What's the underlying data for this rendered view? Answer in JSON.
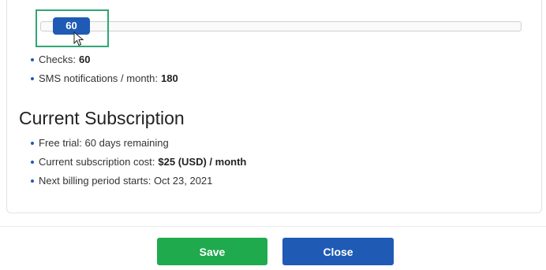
{
  "slider": {
    "value": "60",
    "value_fraction": 0.04
  },
  "plan": {
    "items": [
      {
        "label": "Checks:",
        "value": "60"
      },
      {
        "label": "SMS notifications / month:",
        "value": "180"
      }
    ]
  },
  "current_subscription": {
    "title": "Current Subscription",
    "items": [
      {
        "label": "Free trial: 60 days remaining",
        "value": ""
      },
      {
        "label": "Current subscription cost:",
        "value": "$25 (USD) / month"
      },
      {
        "label": "Next billing period starts: Oct 23, 2021",
        "value": ""
      }
    ]
  },
  "buttons": {
    "save_label": "Save",
    "close_label": "Close"
  },
  "colors": {
    "accent_blue": "#1f5bb5",
    "save_green": "#1faa4e",
    "highlight_green": "#2fa674"
  },
  "icons": {
    "bullet": "bullet-dot-icon",
    "cursor": "mouse-pointer-icon"
  }
}
